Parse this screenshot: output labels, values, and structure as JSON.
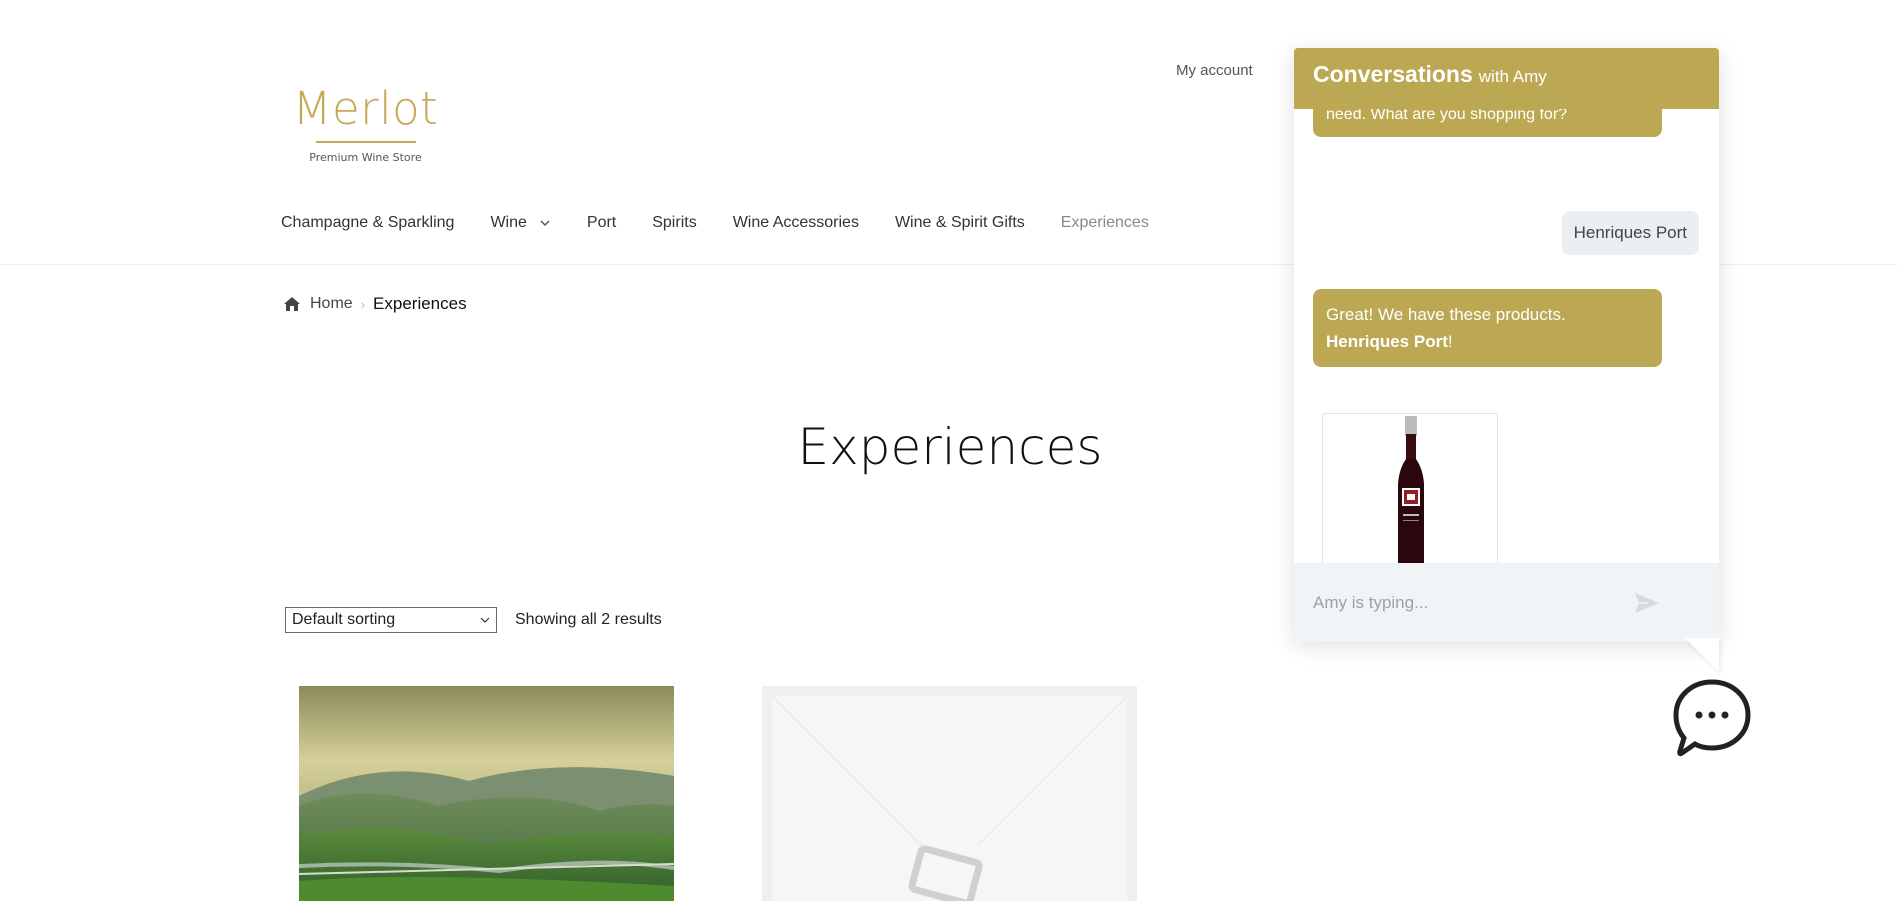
{
  "header": {
    "logo": {
      "name": "Merlot",
      "tagline": "Premium Wine Store"
    },
    "my_account": "My account"
  },
  "nav": {
    "items": [
      {
        "label": "Champagne & Sparkling"
      },
      {
        "label": "Wine",
        "has_dropdown": true
      },
      {
        "label": "Port"
      },
      {
        "label": "Spirits"
      },
      {
        "label": "Wine Accessories"
      },
      {
        "label": "Wine & Spirit Gifts"
      },
      {
        "label": "Experiences",
        "active": true
      }
    ]
  },
  "breadcrumb": {
    "home": "Home",
    "current": "Experiences"
  },
  "page": {
    "title": "Experiences"
  },
  "shop": {
    "sorting": {
      "selected": "Default sorting"
    },
    "result_count": "Showing all 2 results"
  },
  "chat": {
    "title": "Conversations",
    "subtitle": "with Amy",
    "messages": {
      "partial_bot": "need. What are you shopping for?",
      "user": "Henriques Port",
      "bot_line1": "Great! We have these products.",
      "bot_product": "Henriques Port",
      "bot_suffix": "!"
    },
    "input_placeholder": "Amy is typing..."
  },
  "colors": {
    "brand_gold": "#bca853",
    "logo_gold": "#c6a85a",
    "user_bubble": "#eaeff3",
    "input_bg": "#f1f4f7"
  },
  "icons": {
    "home": "home-icon",
    "send": "send-icon",
    "chat_launcher": "chat-bubble-icon",
    "dropdown": "chevron-down-icon"
  }
}
